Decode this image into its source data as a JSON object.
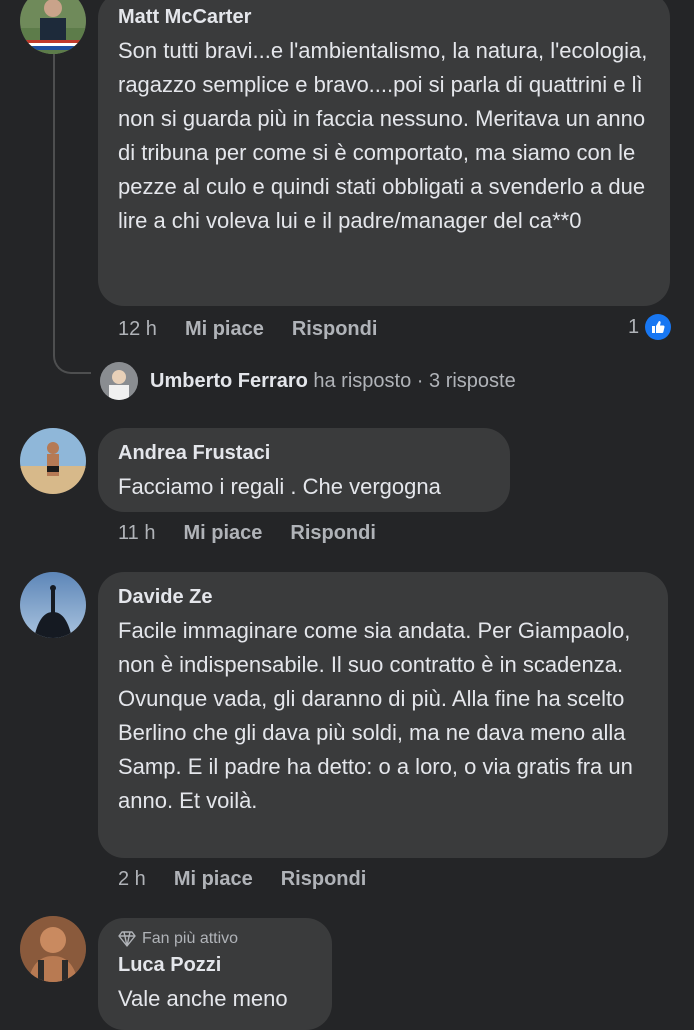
{
  "comments": [
    {
      "author": "Matt McCarter",
      "text": "Son tutti bravi...e l'ambientalismo, la natura, l'ecologia, ragazzo semplice e bravo....poi si parla di quattrini e lì non si guarda più in faccia nessuno. Meritava un anno di tribuna per come si è comportato, ma siamo con le pezze al culo e quindi stati obbligati a svenderlo a due lire a chi voleva lui e il padre/manager del ca**0",
      "time": "12 h",
      "like_label": "Mi piace",
      "reply_label": "Rispondi",
      "reaction_count": "1",
      "reply_summary": {
        "name": "Umberto Ferraro",
        "action": "ha risposto",
        "separator": "·",
        "count": "3 risposte"
      }
    },
    {
      "author": "Andrea Frustaci",
      "text": "Facciamo i regali . Che vergogna",
      "time": "11 h",
      "like_label": "Mi piace",
      "reply_label": "Rispondi"
    },
    {
      "author": "Davide Ze",
      "text": "Facile immaginare come sia andata. Per Giampaolo, non è indispensabile. Il suo contratto è in scadenza. Ovunque vada, gli daranno di più. Alla fine ha scelto Berlino che gli dava più soldi, ma ne dava meno alla Samp. E il padre ha detto: o a loro, o via gratis fra un anno. Et voilà.",
      "time": "2 h",
      "like_label": "Mi piace",
      "reply_label": "Rispondi"
    },
    {
      "badge": "Fan più attivo",
      "author": "Luca Pozzi",
      "text": "Vale anche meno"
    }
  ],
  "colors": {
    "background": "#242527",
    "bubble": "#3a3b3c",
    "like_badge": "#1877f2",
    "secondary_text": "#b0b3b8"
  }
}
